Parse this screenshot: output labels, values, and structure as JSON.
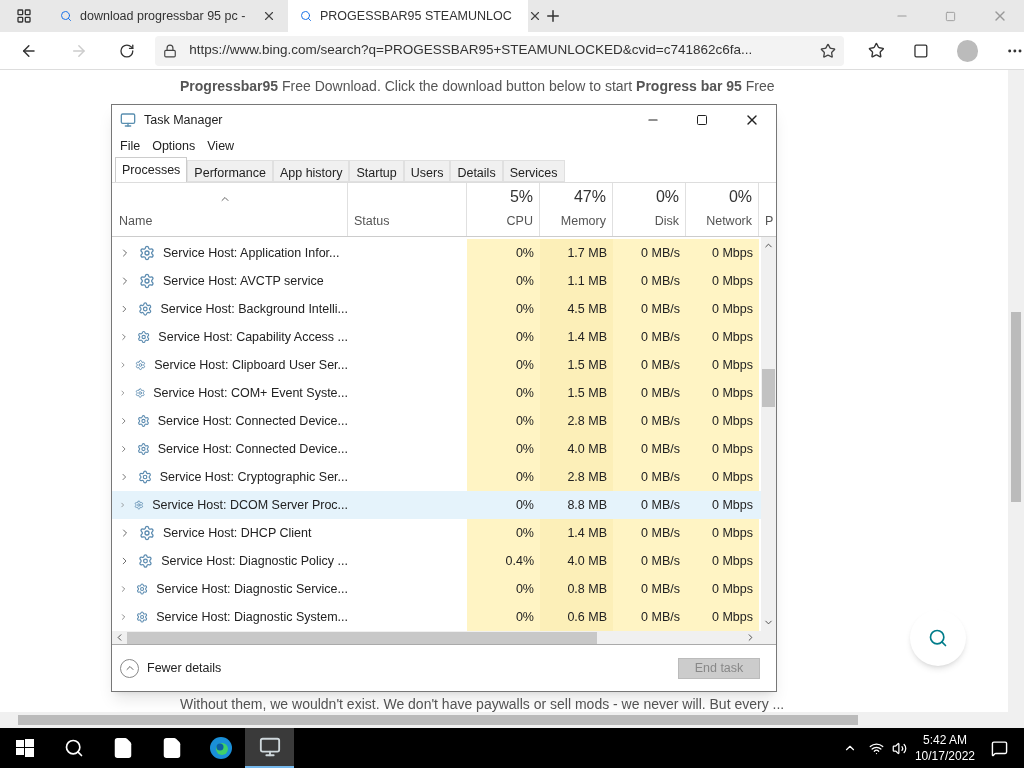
{
  "browser": {
    "tabs": [
      {
        "title": "download progressbar 95 pc -",
        "selected": false
      },
      {
        "title": "PROGESSBAR95 STEAMUNLOC",
        "selected": true
      }
    ],
    "address": "https://www.bing.com/search?q=PROGESSBAR95+STEAMUNLOCKED&cvid=c741862c6fa..."
  },
  "page": {
    "intro": "**Progressbar95** Free Download. Click the download button below to start **Progress bar 95** Free",
    "footer_text": "Without them, we wouldn't exist. We don't have paywalls or sell mods - we never will. But every ..."
  },
  "task_manager": {
    "title": "Task Manager",
    "menu": [
      "File",
      "Options",
      "View"
    ],
    "tabs": [
      {
        "label": "Processes",
        "selected": true
      },
      {
        "label": "Performance",
        "selected": false
      },
      {
        "label": "App history",
        "selected": false
      },
      {
        "label": "Startup",
        "selected": false
      },
      {
        "label": "Users",
        "selected": false
      },
      {
        "label": "Details",
        "selected": false
      },
      {
        "label": "Services",
        "selected": false
      }
    ],
    "columns": [
      {
        "label": "Name",
        "kind": "name"
      },
      {
        "label": "Status",
        "kind": "status"
      },
      {
        "label": "CPU",
        "usage": "5%",
        "kind": "metric"
      },
      {
        "label": "Memory",
        "usage": "47%",
        "kind": "metric"
      },
      {
        "label": "Disk",
        "usage": "0%",
        "kind": "metric"
      },
      {
        "label": "Network",
        "usage": "0%",
        "kind": "metric"
      },
      {
        "label": "P",
        "kind": "partial"
      }
    ],
    "rows": [
      {
        "name": "Service Host: Application Infor...",
        "cpu": "0%",
        "memory": "1.7 MB",
        "disk": "0 MB/s",
        "network": "0 Mbps",
        "selected": false
      },
      {
        "name": "Service Host: AVCTP service",
        "cpu": "0%",
        "memory": "1.1 MB",
        "disk": "0 MB/s",
        "network": "0 Mbps",
        "selected": false
      },
      {
        "name": "Service Host: Background Intelli...",
        "cpu": "0%",
        "memory": "4.5 MB",
        "disk": "0 MB/s",
        "network": "0 Mbps",
        "selected": false
      },
      {
        "name": "Service Host: Capability Access ...",
        "cpu": "0%",
        "memory": "1.4 MB",
        "disk": "0 MB/s",
        "network": "0 Mbps",
        "selected": false
      },
      {
        "name": "Service Host: Clipboard User Ser...",
        "cpu": "0%",
        "memory": "1.5 MB",
        "disk": "0 MB/s",
        "network": "0 Mbps",
        "selected": false
      },
      {
        "name": "Service Host: COM+ Event Syste...",
        "cpu": "0%",
        "memory": "1.5 MB",
        "disk": "0 MB/s",
        "network": "0 Mbps",
        "selected": false
      },
      {
        "name": "Service Host: Connected Device...",
        "cpu": "0%",
        "memory": "2.8 MB",
        "disk": "0 MB/s",
        "network": "0 Mbps",
        "selected": false
      },
      {
        "name": "Service Host: Connected Device...",
        "cpu": "0%",
        "memory": "4.0 MB",
        "disk": "0 MB/s",
        "network": "0 Mbps",
        "selected": false
      },
      {
        "name": "Service Host: Cryptographic Ser...",
        "cpu": "0%",
        "memory": "2.8 MB",
        "disk": "0 MB/s",
        "network": "0 Mbps",
        "selected": false
      },
      {
        "name": "Service Host: DCOM Server Proc...",
        "cpu": "0%",
        "memory": "8.8 MB",
        "disk": "0 MB/s",
        "network": "0 Mbps",
        "selected": true
      },
      {
        "name": "Service Host: DHCP Client",
        "cpu": "0%",
        "memory": "1.4 MB",
        "disk": "0 MB/s",
        "network": "0 Mbps",
        "selected": false
      },
      {
        "name": "Service Host: Diagnostic Policy ...",
        "cpu": "0.4%",
        "memory": "4.0 MB",
        "disk": "0 MB/s",
        "network": "0 Mbps",
        "selected": false
      },
      {
        "name": "Service Host: Diagnostic Service...",
        "cpu": "0%",
        "memory": "0.8 MB",
        "disk": "0 MB/s",
        "network": "0 Mbps",
        "selected": false
      },
      {
        "name": "Service Host: Diagnostic System...",
        "cpu": "0%",
        "memory": "0.6 MB",
        "disk": "0 MB/s",
        "network": "0 Mbps",
        "selected": false
      }
    ],
    "fewer_details": "Fewer details",
    "end_task": {
      "label": "End task",
      "disabled": true
    }
  },
  "taskbar": {
    "apps": [
      {
        "kind": "start",
        "active": false
      },
      {
        "kind": "search",
        "active": false
      },
      {
        "kind": "file",
        "active": false
      },
      {
        "kind": "file",
        "active": false
      },
      {
        "kind": "edge",
        "active": false
      },
      {
        "kind": "taskmgr",
        "active": true
      }
    ],
    "time": "5:42 AM",
    "date": "10/17/2022"
  }
}
